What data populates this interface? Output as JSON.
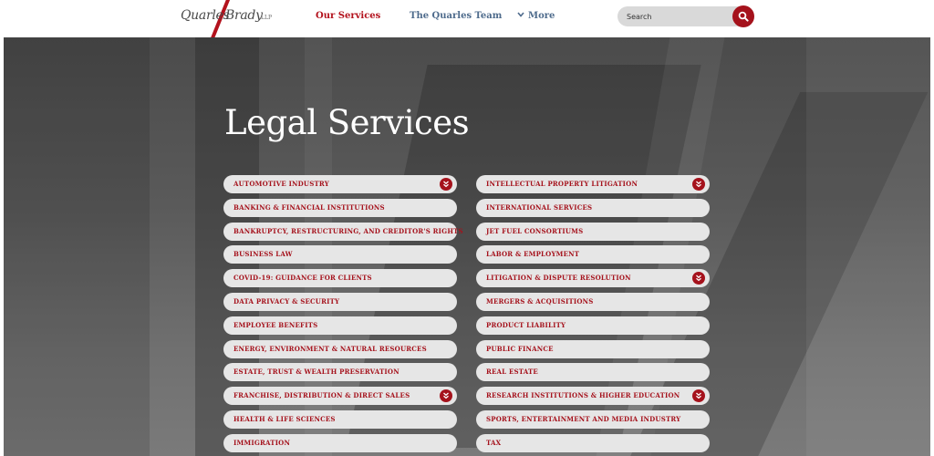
{
  "header": {
    "logo": {
      "word1": "Quarles",
      "word2": "Brady",
      "suffix": "LLP"
    },
    "nav": {
      "services_label": "Our Services",
      "team_label": "The Quarles Team",
      "more_label": "More"
    },
    "search": {
      "placeholder": "Search"
    }
  },
  "hero": {
    "title": "Legal Services",
    "left_column": [
      {
        "label": "AUTOMOTIVE INDUSTRY",
        "expandable": true
      },
      {
        "label": "BANKING & FINANCIAL INSTITUTIONS",
        "expandable": false
      },
      {
        "label": "BANKRUPTCY, RESTRUCTURING, AND CREDITOR'S RIGHTS",
        "expandable": false
      },
      {
        "label": "BUSINESS LAW",
        "expandable": false
      },
      {
        "label": "COVID-19: GUIDANCE FOR CLIENTS",
        "expandable": false
      },
      {
        "label": "DATA PRIVACY & SECURITY",
        "expandable": false
      },
      {
        "label": "EMPLOYEE BENEFITS",
        "expandable": false
      },
      {
        "label": "ENERGY, ENVIRONMENT & NATURAL RESOURCES",
        "expandable": false
      },
      {
        "label": "ESTATE, TRUST & WEALTH PRESERVATION",
        "expandable": false
      },
      {
        "label": "FRANCHISE, DISTRIBUTION & DIRECT SALES",
        "expandable": true
      },
      {
        "label": "HEALTH & LIFE SCIENCES",
        "expandable": false
      },
      {
        "label": "IMMIGRATION",
        "expandable": false
      }
    ],
    "right_column": [
      {
        "label": "INTELLECTUAL PROPERTY LITIGATION",
        "expandable": true
      },
      {
        "label": "INTERNATIONAL SERVICES",
        "expandable": false
      },
      {
        "label": "JET FUEL CONSORTIUMS",
        "expandable": false
      },
      {
        "label": "LABOR & EMPLOYMENT",
        "expandable": false
      },
      {
        "label": "LITIGATION & DISPUTE RESOLUTION",
        "expandable": true
      },
      {
        "label": "MERGERS & ACQUISITIONS",
        "expandable": false
      },
      {
        "label": "PRODUCT LIABILITY",
        "expandable": false
      },
      {
        "label": "PUBLIC FINANCE",
        "expandable": false
      },
      {
        "label": "REAL ESTATE",
        "expandable": false
      },
      {
        "label": "RESEARCH INSTITUTIONS & HIGHER EDUCATION",
        "expandable": true
      },
      {
        "label": "SPORTS, ENTERTAINMENT AND MEDIA INDUSTRY",
        "expandable": false
      },
      {
        "label": "TAX",
        "expandable": false
      }
    ]
  },
  "colors": {
    "brand_red": "#a5121c",
    "nav_blue": "#4e6b8c",
    "pill_bg": "#e6e6e6"
  },
  "icons": {
    "search": "search-icon",
    "expand": "double-chevron-down-icon",
    "more": "chevron-down-icon"
  }
}
